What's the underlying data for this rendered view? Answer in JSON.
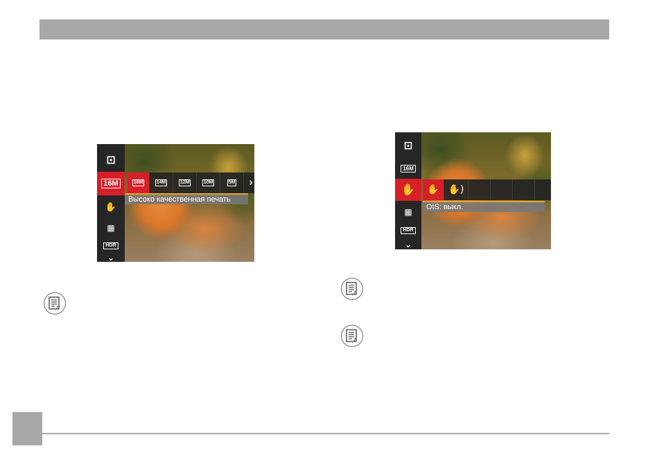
{
  "page": {
    "number": ""
  },
  "left_screen": {
    "sidebar": [
      {
        "icon": "metering-icon",
        "glyph": "⊡"
      },
      {
        "icon": "image-size-16m-icon",
        "label": "16M",
        "active": true
      },
      {
        "icon": "ois-off-icon",
        "glyph": "✋"
      },
      {
        "icon": "color-effect-icon",
        "glyph": "▦"
      },
      {
        "icon": "hdr-off-icon",
        "label": "HDR"
      },
      {
        "icon": "chevron-down-icon",
        "glyph": "⌄"
      }
    ],
    "options": [
      "16M",
      "14M",
      "12M",
      "10M",
      "5M"
    ],
    "selected_option": "16M",
    "more_glyph": "›",
    "caption": "Высоко качественная печать"
  },
  "right_screen": {
    "sidebar": [
      {
        "icon": "metering-icon",
        "glyph": "⊡"
      },
      {
        "icon": "image-size-16m-icon",
        "label": "16M"
      },
      {
        "icon": "ois-off-icon",
        "glyph": "✋",
        "active": true
      },
      {
        "icon": "color-effect-icon",
        "glyph": "▦"
      },
      {
        "icon": "hdr-off-icon",
        "label": "HDR"
      },
      {
        "icon": "chevron-down-icon",
        "glyph": "⌄"
      }
    ],
    "options": [
      "OIS off",
      "OIS on"
    ],
    "option_glyphs": [
      "✋",
      "✋)"
    ],
    "caption": "OIS: выкл."
  },
  "notes": [
    {
      "icon": "note-icon"
    },
    {
      "icon": "note-icon"
    },
    {
      "icon": "note-icon"
    }
  ],
  "colors": {
    "accent_red": "#d61f26",
    "header_gray": "#a7a8aa",
    "caption_line": "#e6a72a"
  }
}
